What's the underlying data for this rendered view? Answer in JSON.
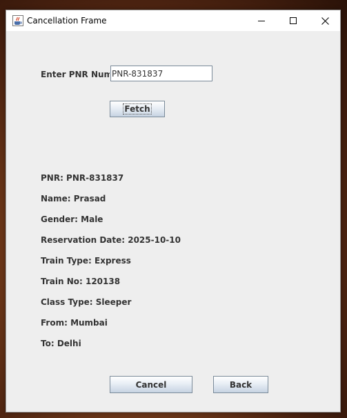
{
  "window": {
    "title": "Cancellation Frame",
    "icon": "java-cup-icon",
    "controls": {
      "minimize_icon": "minimize-icon",
      "maximize_icon": "maximize-icon",
      "close_icon": "close-icon"
    }
  },
  "form": {
    "pnr_label": "Enter PNR Number:",
    "pnr_value": "PNR-831837",
    "fetch_label": "Fetch"
  },
  "details": [
    "PNR: PNR-831837",
    "Name: Prasad",
    "Gender: Male",
    "Reservation Date: 2025-10-10",
    "Train Type: Express",
    "Train No: 120138",
    "Class Type: Sleeper",
    "From: Mumbai",
    "To: Delhi"
  ],
  "actions": {
    "cancel_label": "Cancel",
    "back_label": "Back"
  },
  "colors": {
    "window_bg": "#eeeeee",
    "text": "#333333",
    "button_border": "#7a8a99"
  }
}
